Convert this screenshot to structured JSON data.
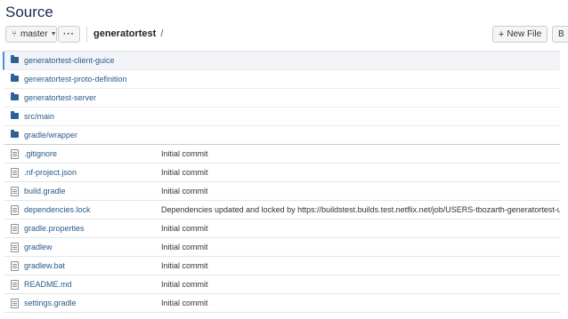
{
  "page": {
    "title": "Source"
  },
  "toolbar": {
    "branch_label": "master",
    "more_label": "···",
    "repo_name": "generatortest",
    "path_sep": "/",
    "new_file_label": "New File",
    "cut_button_label": "B"
  },
  "entries": [
    {
      "type": "folder",
      "name": "generatortest-client-guice",
      "message": "",
      "selected": true
    },
    {
      "type": "folder",
      "name": "generatortest-proto-definition",
      "message": ""
    },
    {
      "type": "folder",
      "name": "generatortest-server",
      "message": ""
    },
    {
      "type": "folder",
      "name": "src/main",
      "message": ""
    },
    {
      "type": "folder",
      "name": "gradle/wrapper",
      "message": ""
    },
    {
      "type": "file",
      "name": ".gitignore",
      "message": "Initial commit"
    },
    {
      "type": "file",
      "name": ".nf-project.json",
      "message": "Initial commit"
    },
    {
      "type": "file",
      "name": "build.gradle",
      "message": "Initial commit"
    },
    {
      "type": "file",
      "name": "dependencies.lock",
      "message": "Dependencies updated and locked by https://buildstest.builds.test.netflix.net/job/USERS-tbozarth-generatortest-update-de"
    },
    {
      "type": "file",
      "name": "gradle.properties",
      "message": "Initial commit"
    },
    {
      "type": "file",
      "name": "gradlew",
      "message": "Initial commit"
    },
    {
      "type": "file",
      "name": "gradlew.bat",
      "message": "Initial commit"
    },
    {
      "type": "file",
      "name": "README.md",
      "message": "Initial commit"
    },
    {
      "type": "file",
      "name": "settings.gradle",
      "message": "Initial commit"
    }
  ],
  "colors": {
    "link": "#2a5a8a",
    "folder": "#2e5f96",
    "selected_bg": "#f2f4f8",
    "selected_border": "#4a90d9"
  },
  "icons": {
    "branch": "branch-icon",
    "folder": "folder-icon",
    "file": "file-icon",
    "plus": "plus-icon"
  }
}
